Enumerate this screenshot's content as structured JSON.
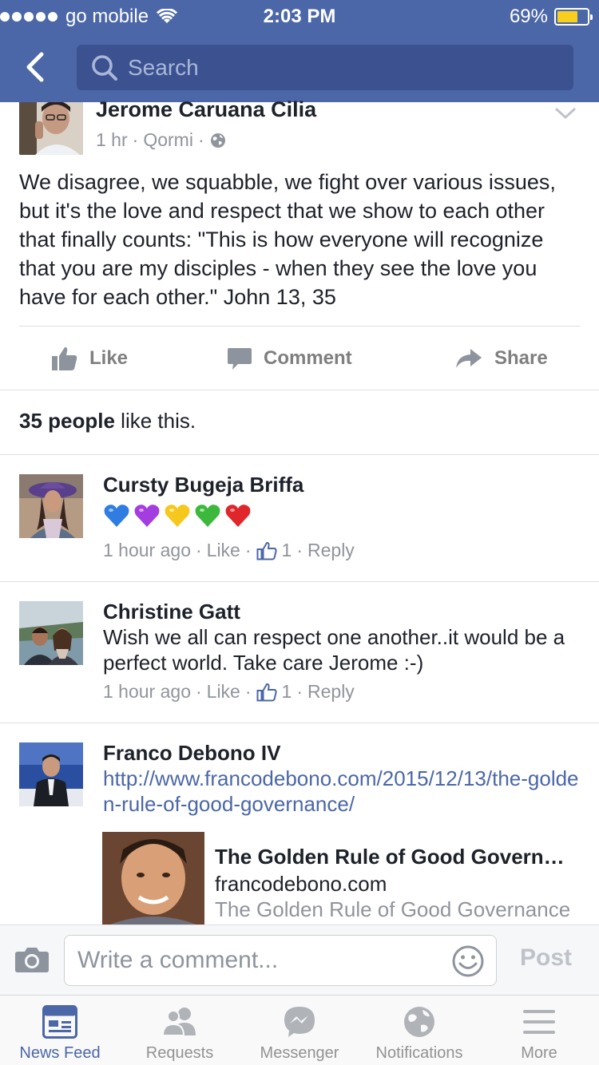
{
  "status_bar": {
    "carrier": "go mobile",
    "time": "2:03 PM",
    "battery": "69%",
    "battery_level": 0.69
  },
  "nav": {
    "search_placeholder": "Search"
  },
  "post": {
    "author": "Jerome Caruana Cilia",
    "time": "1 hr",
    "location": "Qormi",
    "separator": "·",
    "text": "We disagree, we squabble, we fight over various issues, but it's the love and respect that we show to each other that finally counts: \"This is how everyone will recognize that you are my disciples - when they see the love you have for each other.\" John 13, 35",
    "actions": {
      "like": "Like",
      "comment": "Comment",
      "share": "Share"
    },
    "likes_bold": "35 people",
    "likes_rest": " like this."
  },
  "comments": [
    {
      "name": "Cursty Bugeja Briffa",
      "emoji": [
        "blue-heart",
        "purple-heart",
        "yellow-heart",
        "green-heart",
        "red-heart"
      ],
      "time": "1 hour ago",
      "like": "Like",
      "like_count": "1",
      "reply": "Reply"
    },
    {
      "name": "Christine Gatt",
      "text": "Wish we all can respect one another..it would be a perfect world. Take care Jerome :-)",
      "time": "1 hour ago",
      "like": "Like",
      "like_count": "1",
      "reply": "Reply"
    },
    {
      "name": "Franco Debono IV",
      "link": "http://www.francodebono.com/2015/12/13/the-golden-rule-of-good-governance/",
      "preview": {
        "title": "The Golden Rule of Good Governance",
        "domain": "francodebono.com",
        "description": "The Golden Rule of Good Governance"
      }
    }
  ],
  "composer": {
    "placeholder": "Write a comment...",
    "post_label": "Post"
  },
  "tabs": [
    {
      "label": "News Feed",
      "icon": "news-feed-icon",
      "active": true
    },
    {
      "label": "Requests",
      "icon": "friend-requests-icon",
      "active": false
    },
    {
      "label": "Messenger",
      "icon": "messenger-icon",
      "active": false
    },
    {
      "label": "Notifications",
      "icon": "globe-icon",
      "active": false
    },
    {
      "label": "More",
      "icon": "menu-icon",
      "active": false
    }
  ],
  "colors": {
    "brand": "#4b67a8",
    "brand_dark": "#3c5290",
    "link": "#4b67a8",
    "meta_gray": "#90949c",
    "battery_yellow": "#f7cf1c"
  }
}
